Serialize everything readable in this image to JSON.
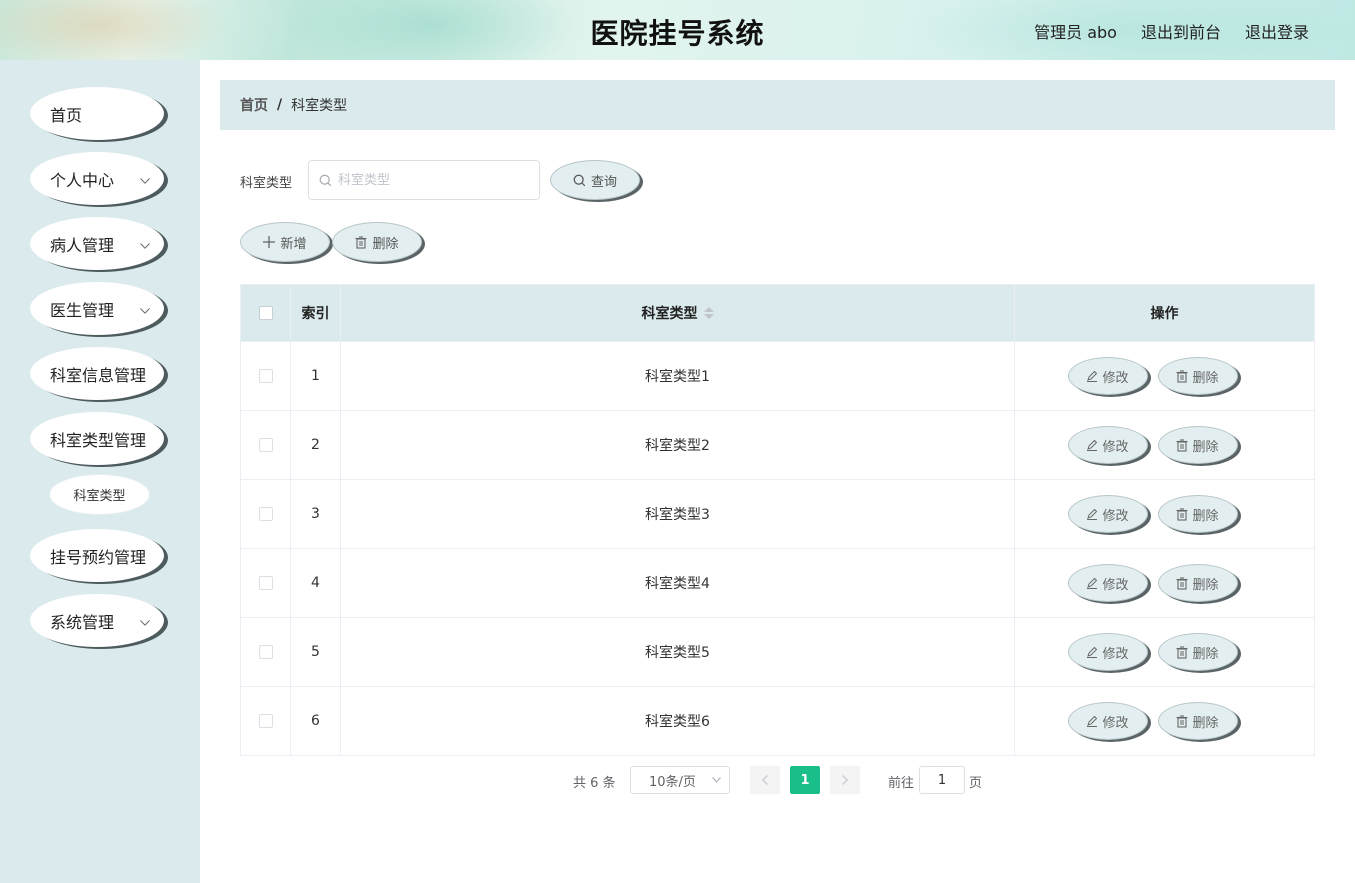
{
  "header": {
    "title": "医院挂号系统",
    "user_label": "管理员 abo",
    "front_link": "退出到前台",
    "logout_link": "退出登录"
  },
  "sidebar": {
    "items": [
      {
        "label": "首页",
        "has_children": false
      },
      {
        "label": "个人中心",
        "has_children": true
      },
      {
        "label": "病人管理",
        "has_children": true
      },
      {
        "label": "医生管理",
        "has_children": true
      },
      {
        "label": "科室信息管理",
        "has_children": false
      },
      {
        "label": "科室类型管理",
        "has_children": false
      },
      {
        "label": "挂号预约管理",
        "has_children": false
      },
      {
        "label": "系统管理",
        "has_children": true
      }
    ],
    "sub_item": "科室类型"
  },
  "breadcrumb": {
    "home": "首页",
    "separator": "/",
    "current": "科室类型"
  },
  "search": {
    "label": "科室类型",
    "placeholder": "科室类型",
    "value": "",
    "query_button": "查询"
  },
  "actions": {
    "add_button": "新增",
    "delete_button": "删除"
  },
  "table": {
    "headers": {
      "index": "索引",
      "type": "科室类型",
      "op": "操作"
    },
    "edit_label": "修改",
    "delete_label": "删除",
    "rows": [
      {
        "index": "1",
        "type": "科室类型1"
      },
      {
        "index": "2",
        "type": "科室类型2"
      },
      {
        "index": "3",
        "type": "科室类型3"
      },
      {
        "index": "4",
        "type": "科室类型4"
      },
      {
        "index": "5",
        "type": "科室类型5"
      },
      {
        "index": "6",
        "type": "科室类型6"
      }
    ]
  },
  "pagination": {
    "total": "共 6 条",
    "page_size": "10条/页",
    "current_page": "1",
    "goto_label": "前往",
    "goto_value": "1",
    "page_suffix": "页"
  },
  "colors": {
    "accent": "#19be8b",
    "panel": "#dbeaec",
    "button_shadow": "#5a6466"
  }
}
